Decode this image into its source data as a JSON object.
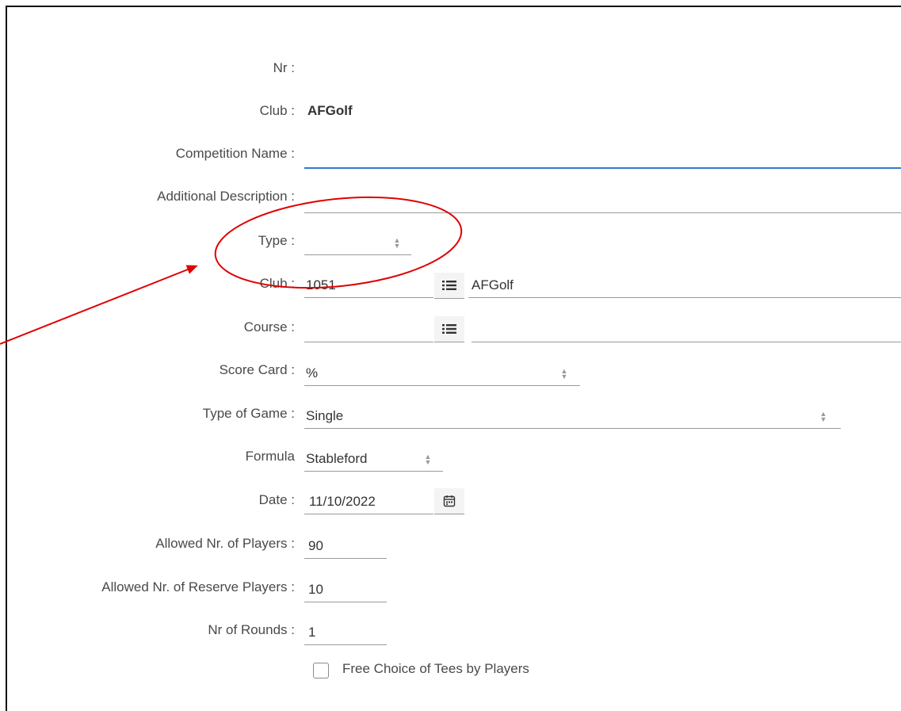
{
  "form": {
    "nr": {
      "label": "Nr :",
      "value": ""
    },
    "club_header": {
      "label": "Club :",
      "value": "AFGolf"
    },
    "competition_name": {
      "label": "Competition Name :",
      "value": ""
    },
    "additional_description": {
      "label": "Additional Description :",
      "value": ""
    },
    "type": {
      "label": "Type :",
      "value": ""
    },
    "club": {
      "label": "Club :",
      "code": "1051",
      "name": "AFGolf"
    },
    "course": {
      "label": "Course :",
      "code": "",
      "name": ""
    },
    "score_card": {
      "label": "Score Card :",
      "value": "%"
    },
    "type_of_game": {
      "label": "Type of Game :",
      "value": "Single"
    },
    "formula": {
      "label": "Formula",
      "value": "Stableford"
    },
    "date": {
      "label": "Date :",
      "value": "11/10/2022"
    },
    "allowed_players": {
      "label": "Allowed Nr. of Players :",
      "value": "90"
    },
    "allowed_reserve_players": {
      "label": "Allowed Nr. of Reserve Players :",
      "value": "10"
    },
    "nr_of_rounds": {
      "label": "Nr of Rounds :",
      "value": "1"
    },
    "free_choice_tees": {
      "label": "Free Choice of Tees by Players",
      "checked": false
    }
  },
  "annotation": {
    "color": "#e00000",
    "shapes": [
      "ellipse",
      "arrow"
    ]
  },
  "colors": {
    "accent": "#2f7bd1",
    "annotation": "#e00000"
  }
}
